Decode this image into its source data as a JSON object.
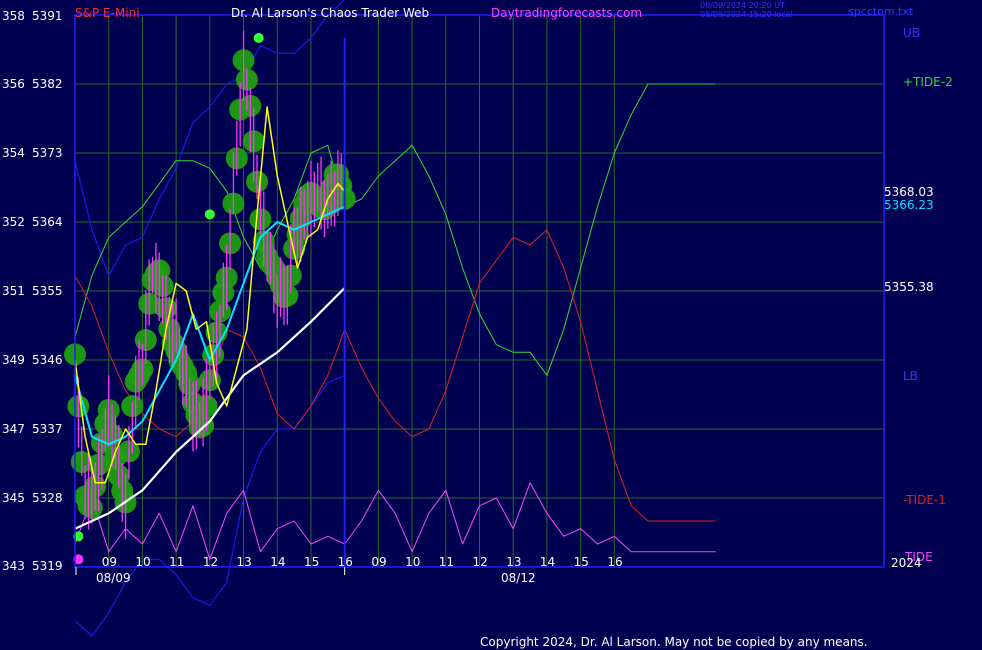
{
  "header": {
    "instrument": "S&P E-Mini",
    "author": "Dr. Al Larson's Chaos Trader Web",
    "site": "Daytradingforecasts.com",
    "stamp_utc": "08/09/2024 20:20 UT",
    "stamp_local": "08/09/2024 15:20 local",
    "file": "spcctom.txt"
  },
  "footer": {
    "copyright": "Copyright 2024, Dr. Al Larson. May not be copied by any means."
  },
  "colors": {
    "background": "#000050",
    "grid": "#2a6a2a",
    "frame": "#2020ff",
    "price_bar": "#ff33ff",
    "dots": "#1f9e10",
    "fast_ma": "#ffff00",
    "mid_ma": "#00e5ff",
    "slow_ma": "#ffffff",
    "tide2": "#33dd33",
    "tide1": "#dd2020",
    "tide": "#ff44ff",
    "band": "#1a1ae6"
  },
  "chart_data": {
    "type": "line",
    "y_axis": {
      "pairs": [
        {
          "count": "358",
          "price": "5391"
        },
        {
          "count": "356",
          "price": "5382"
        },
        {
          "count": "354",
          "price": "5373"
        },
        {
          "count": "352",
          "price": "5364"
        },
        {
          "count": "351",
          "price": "5355"
        },
        {
          "count": "349",
          "price": "5346"
        },
        {
          "count": "347",
          "price": "5337"
        },
        {
          "count": "345",
          "price": "5328"
        },
        {
          "count": "343",
          "price": "5319"
        }
      ],
      "ylim": [
        5319,
        5391
      ]
    },
    "x_axis": {
      "hour_ticks": [
        "09",
        "10",
        "11",
        "12",
        "13",
        "14",
        "15",
        "16",
        "09",
        "10",
        "11",
        "12",
        "13",
        "14",
        "15",
        "16"
      ],
      "dates": [
        "08/09",
        "08/12"
      ],
      "year": "2024",
      "xlim": [
        8.0,
        32.0
      ],
      "divider_x": 16.0
    },
    "right_labels": {
      "ub": "UB",
      "lb": "LB",
      "tide2": "+TIDE-2",
      "tide1": "-TIDE-1",
      "tide": "TIDE",
      "last_price": "5368.03",
      "mid_ma_value": "5366.23",
      "slow_ma_value": "5355.38"
    },
    "series": [
      {
        "name": "price",
        "x": [
          8.0,
          8.25,
          8.5,
          8.75,
          9.0,
          9.25,
          9.5,
          9.75,
          10.0,
          10.25,
          10.5,
          10.75,
          11.0,
          11.25,
          11.5,
          11.75,
          12.0,
          12.25,
          12.5,
          12.75,
          13.0,
          13.25,
          13.5,
          13.75,
          14.0,
          14.25,
          14.5,
          14.75,
          15.0,
          15.25,
          15.5,
          15.75,
          16.0
        ],
        "y": [
          5345,
          5330,
          5328,
          5332,
          5339,
          5334,
          5327,
          5341,
          5346,
          5357,
          5356,
          5351,
          5349,
          5344,
          5339,
          5338,
          5344,
          5349,
          5357,
          5371,
          5384,
          5376,
          5366,
          5359,
          5355,
          5354,
          5362,
          5364,
          5367,
          5368,
          5366,
          5369,
          5368
        ]
      },
      {
        "name": "fast_ma",
        "x": [
          8.0,
          8.3,
          8.6,
          8.9,
          9.2,
          9.5,
          9.8,
          10.1,
          10.4,
          10.7,
          11.0,
          11.3,
          11.6,
          11.9,
          12.2,
          12.5,
          12.8,
          13.1,
          13.4,
          13.7,
          14.0,
          14.3,
          14.6,
          14.9,
          15.2,
          15.5,
          15.8,
          16.0
        ],
        "y": [
          5346,
          5336,
          5330,
          5330,
          5334,
          5337,
          5335,
          5335,
          5342,
          5350,
          5356,
          5355,
          5350,
          5351,
          5343,
          5340,
          5345,
          5350,
          5365,
          5379,
          5370,
          5364,
          5358,
          5362,
          5363,
          5367,
          5369,
          5368
        ]
      },
      {
        "name": "mid_ma",
        "x": [
          8.0,
          8.5,
          9.0,
          9.5,
          10.0,
          10.5,
          11.0,
          11.5,
          12.0,
          12.5,
          13.0,
          13.5,
          14.0,
          14.5,
          15.0,
          15.5,
          16.0
        ],
        "y": [
          5344,
          5336,
          5335,
          5336,
          5338,
          5342,
          5346,
          5352,
          5346,
          5350,
          5356,
          5362,
          5364,
          5363,
          5364,
          5365,
          5366
        ]
      },
      {
        "name": "slow_ma",
        "x": [
          8.0,
          9.0,
          10.0,
          11.0,
          12.0,
          13.0,
          14.0,
          15.0,
          16.0
        ],
        "y": [
          5324,
          5326,
          5329,
          5334,
          5338,
          5344,
          5347,
          5351,
          5355.4
        ]
      },
      {
        "name": "ub",
        "x": [
          8.0,
          8.5,
          9.0,
          9.5,
          10.0,
          10.5,
          11.0,
          11.5,
          12.0,
          12.5,
          13.0,
          13.5,
          14.0,
          14.5,
          15.0,
          15.5,
          16.0
        ],
        "y": [
          5372,
          5363,
          5357,
          5361,
          5362,
          5367,
          5371,
          5377,
          5379,
          5382,
          5383,
          5387,
          5386,
          5386,
          5388,
          5391,
          5393
        ]
      },
      {
        "name": "lb",
        "x": [
          8.0,
          8.5,
          9.0,
          9.5,
          10.0,
          10.5,
          11.0,
          11.5,
          12.0,
          12.5,
          13.0,
          13.5,
          14.0,
          14.5,
          15.0,
          15.5,
          16.0
        ],
        "y": [
          5312,
          5310,
          5313,
          5317,
          5320,
          5320,
          5318,
          5315,
          5314,
          5317,
          5328,
          5334,
          5337,
          5337,
          5340,
          5343,
          5344
        ]
      },
      {
        "name": "tide2",
        "x": [
          8.0,
          8.5,
          9.0,
          9.5,
          10.0,
          10.5,
          11.0,
          11.5,
          12.0,
          12.5,
          13.0,
          13.5,
          14.0,
          14.5,
          15.0,
          15.5,
          16.0,
          16.5,
          17.0,
          17.5,
          18.0,
          18.5,
          19.0,
          19.5,
          20.0,
          20.5,
          21.0,
          21.5,
          22.0,
          22.5,
          23.0,
          23.5,
          24.0,
          24.5,
          25.0,
          25.5,
          26.0,
          26.5,
          27.0
        ],
        "y": [
          5349,
          5357,
          5362,
          5364,
          5366,
          5369,
          5372,
          5372,
          5371,
          5368,
          5362,
          5358,
          5363,
          5367,
          5373,
          5374,
          5366,
          5367,
          5370,
          5372,
          5374,
          5370,
          5365,
          5358,
          5352,
          5348,
          5347,
          5347,
          5344,
          5350,
          5358,
          5366,
          5373,
          5378,
          5382,
          5382,
          5382,
          5382,
          5382
        ]
      },
      {
        "name": "tide1",
        "x": [
          8.0,
          8.5,
          9.0,
          9.5,
          10.0,
          10.5,
          11.0,
          11.5,
          12.0,
          12.5,
          13.0,
          13.5,
          14.0,
          14.5,
          15.0,
          15.5,
          16.0,
          16.5,
          17.0,
          17.5,
          18.0,
          18.5,
          19.0,
          19.5,
          20.0,
          20.5,
          21.0,
          21.5,
          22.0,
          22.5,
          23.0,
          23.5,
          24.0,
          24.5,
          25.0,
          25.5,
          26.0,
          26.5,
          27.0
        ],
        "y": [
          5357,
          5353,
          5347,
          5342,
          5339,
          5337,
          5336,
          5338,
          5343,
          5350,
          5349,
          5345,
          5339,
          5337,
          5340,
          5344,
          5350,
          5345,
          5341,
          5338,
          5336,
          5337,
          5342,
          5349,
          5356,
          5359,
          5362,
          5361,
          5363,
          5358,
          5351,
          5342,
          5333,
          5327,
          5325,
          5325,
          5325,
          5325,
          5325
        ]
      },
      {
        "name": "tide",
        "x": [
          8.0,
          8.5,
          9.0,
          9.5,
          10.0,
          10.5,
          11.0,
          11.5,
          12.0,
          12.5,
          13.0,
          13.5,
          14.0,
          14.5,
          15.0,
          15.5,
          16.0,
          16.5,
          17.0,
          17.5,
          18.0,
          18.5,
          19.0,
          19.5,
          20.0,
          20.5,
          21.0,
          21.5,
          22.0,
          22.5,
          23.0,
          23.5,
          24.0,
          24.5,
          25.0,
          25.5,
          26.0,
          26.5,
          27.0
        ],
        "y": [
          5322,
          5328,
          5321,
          5324,
          5322,
          5326,
          5321,
          5327,
          5320,
          5326,
          5329,
          5321,
          5324,
          5325,
          5322,
          5323,
          5322,
          5325,
          5329,
          5326,
          5321,
          5326,
          5329,
          5322,
          5327,
          5328,
          5324,
          5330,
          5326,
          5323,
          5324,
          5322,
          5323,
          5321,
          5321,
          5321,
          5321,
          5321,
          5321
        ]
      },
      {
        "name": "high_points",
        "x": [
          12.0,
          13.45
        ],
        "y": [
          5365,
          5388
        ]
      },
      {
        "name": "low_points",
        "x": [
          8.1,
          8.1
        ],
        "y": [
          5323,
          5320
        ]
      }
    ]
  }
}
